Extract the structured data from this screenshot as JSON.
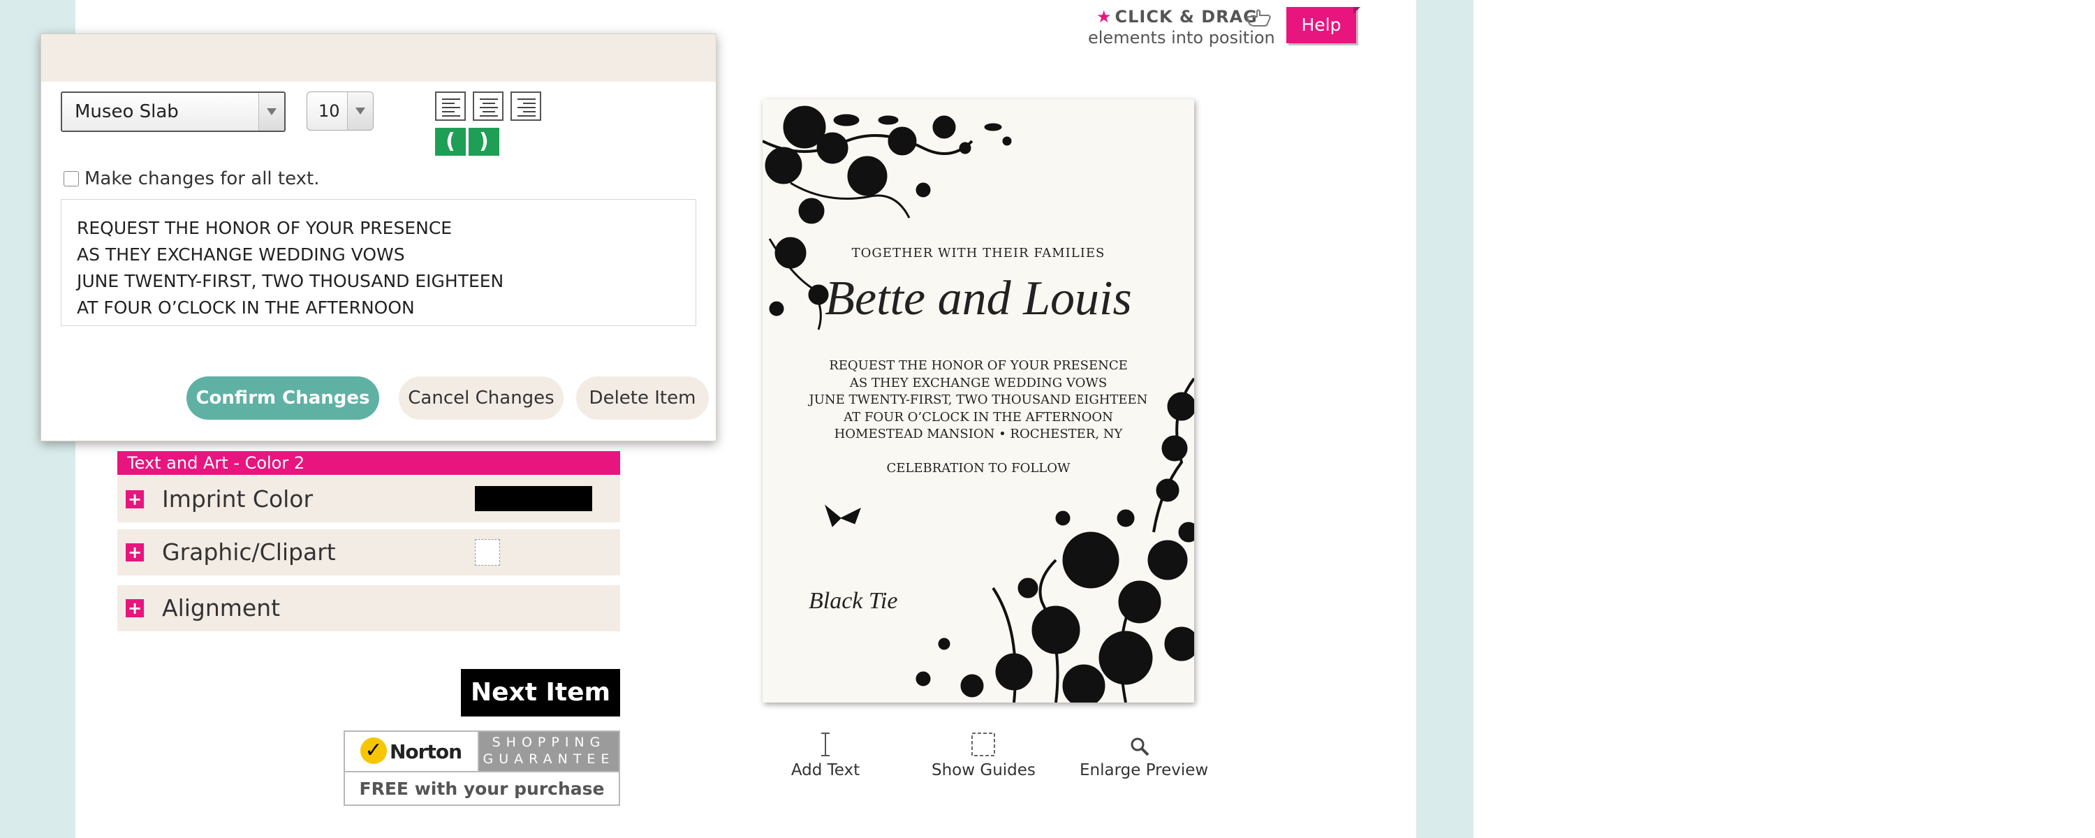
{
  "drag_tip": {
    "line1": "CLICK & DRAG",
    "line2": "elements into position"
  },
  "help": {
    "label": "Help"
  },
  "editor": {
    "font": {
      "selected": "Museo Slab"
    },
    "size": {
      "selected": "10"
    },
    "align_buttons": [
      "align-left",
      "align-center",
      "align-right"
    ],
    "curve_buttons": [
      "(",
      ")"
    ],
    "apply_all_label": "Make changes for all text.",
    "text_lines": [
      "REQUEST THE HONOR OF YOUR PRESENCE",
      "AS THEY EXCHANGE WEDDING VOWS",
      "JUNE TWENTY-FIRST, TWO THOUSAND EIGHTEEN",
      "AT FOUR O’CLOCK IN THE AFTERNOON"
    ],
    "confirm_label": "Confirm Changes",
    "cancel_label": "Cancel Changes",
    "delete_label": "Delete Item"
  },
  "color_panel": {
    "header": "Text and Art - Color 2",
    "rows": [
      {
        "label": "Imprint Color",
        "swatch": "#000000"
      },
      {
        "label": "Graphic/Clipart"
      },
      {
        "label": "Alignment"
      }
    ],
    "next_label": "Next Item"
  },
  "norton": {
    "brand": "Norton",
    "tag1": "SHOPPING",
    "tag2": "GUARANTEE",
    "free": "FREE with your purchase"
  },
  "card": {
    "together": "TOGETHER WITH THEIR FAMILIES",
    "names": "Bette and Louis",
    "body": [
      "REQUEST THE HONOR OF YOUR PRESENCE",
      "AS THEY EXCHANGE WEDDING VOWS",
      "JUNE TWENTY-FIRST, TWO THOUSAND EIGHTEEN",
      "AT FOUR O’CLOCK IN THE AFTERNOON",
      "HOMESTEAD MANSION • ROCHESTER, NY"
    ],
    "celebration": "CELEBRATION TO FOLLOW",
    "attire": "Black Tie"
  },
  "toolbar": {
    "add_text": "Add Text",
    "show_guides": "Show Guides",
    "enlarge": "Enlarge Preview"
  },
  "colors": {
    "accent_pink": "#e8157f",
    "confirm_teal": "#5fb1a4",
    "curve_green": "#1f9e56",
    "panel_beige": "#f3ece4",
    "page_bg": "#d9ebea"
  }
}
